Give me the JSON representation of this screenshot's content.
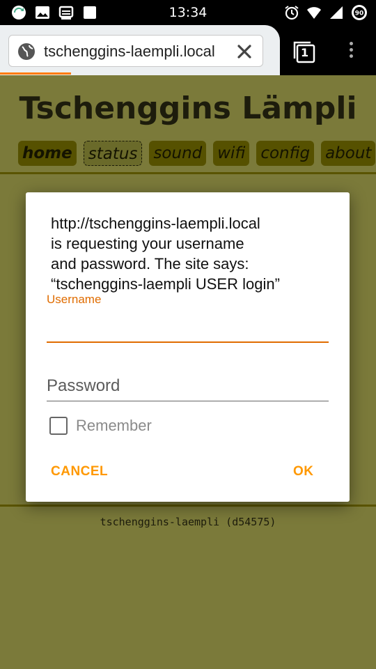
{
  "status_bar": {
    "time": "13:34",
    "battery": "90",
    "left_icons": [
      "sync-icon",
      "image-icon",
      "cast-icon",
      "square-icon"
    ],
    "right_icons": [
      "alarm-icon",
      "wifi-icon",
      "signal-icon",
      "battery-icon"
    ]
  },
  "browser": {
    "url": "tschenggins-laempli.local",
    "tab_count": "1"
  },
  "page": {
    "title": "Tschenggins Lämpli",
    "nav": [
      "home",
      "status",
      "sound",
      "wifi",
      "config",
      "about"
    ],
    "footer": "tschenggins-laempli (d54575)"
  },
  "dialog": {
    "message_lines": [
      "http://tschenggins-laempli.local",
      "is requesting your username",
      "and password. The site says:",
      "“tschenggins-laempli USER login”"
    ],
    "username_label": "Username",
    "username_value": "",
    "password_placeholder": "Password",
    "remember_label": "Remember",
    "remember_checked": false,
    "cancel_label": "CANCEL",
    "ok_label": "OK"
  },
  "colors": {
    "accent": "#ff9800",
    "field_active": "#e06c00",
    "page_bg_dimmed": "#7b7a3a",
    "nav_bg": "#565100"
  }
}
